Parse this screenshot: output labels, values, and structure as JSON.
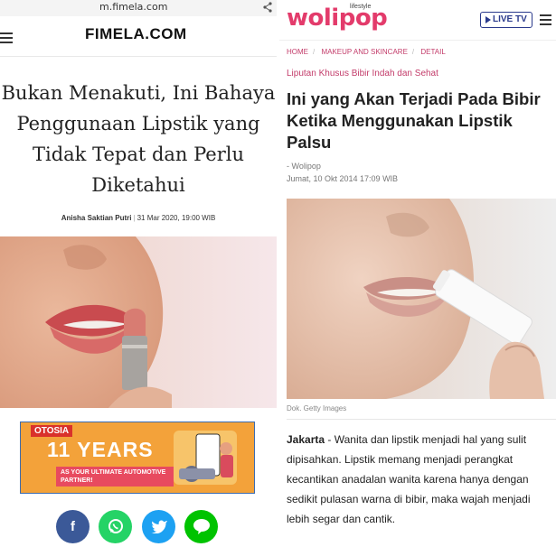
{
  "left": {
    "url": "m.fimela.com",
    "logo": "FIMELA.COM",
    "title": "Bukan Menakuti, Ini Bahaya Penggunaan Lipstik yang Tidak Tepat dan Perlu Diketahui",
    "author": "Anisha Saktian Putri",
    "date": "31 Mar 2020, 19:00 WIB",
    "ad": {
      "brand": "OTOSIA",
      "headline": "11 YEARS",
      "tagline": "AS YOUR ULTIMATE AUTOMOTIVE PARTNER!"
    },
    "share_buttons": [
      {
        "label": "f",
        "icon": "facebook-icon",
        "color": "#3b5998"
      },
      {
        "label": "✆",
        "icon": "whatsapp-icon",
        "color": "#25d366"
      },
      {
        "label": "t",
        "icon": "twitter-icon",
        "color": "#1da1f2"
      },
      {
        "label": "LINE",
        "icon": "line-icon",
        "color": "#00c300"
      }
    ]
  },
  "right": {
    "logo": "wolipop",
    "logo_sub": "lifestyle",
    "live_tv": "LIVE TV",
    "breadcrumb": [
      "HOME",
      "MAKEUP AND SKINCARE",
      "DETAIL"
    ],
    "topic": "Liputan Khusus Bibir Indah dan Sehat",
    "title": "Ini yang Akan Terjadi Pada Bibir Ketika Menggunakan Lipstik Palsu",
    "source": "- Wolipop",
    "date": "Jumat, 10 Okt 2014 17:09 WIB",
    "photo_caption": "Dok. Getty Images",
    "body_lead": "Jakarta",
    "body_text": " - Wanita dan lipstik menjadi hal yang sulit dipisahkan. Lipstik memang menjadi perangkat kecantikan anadalan wanita karena hanya dengan sedikit pulasan warna di bibir, maka wajah menjadi lebih segar dan cantik."
  },
  "colors": {
    "wolipop_pink": "#e33b6b",
    "live_blue": "#2a3a8c",
    "ad_orange": "#f3a23a"
  }
}
